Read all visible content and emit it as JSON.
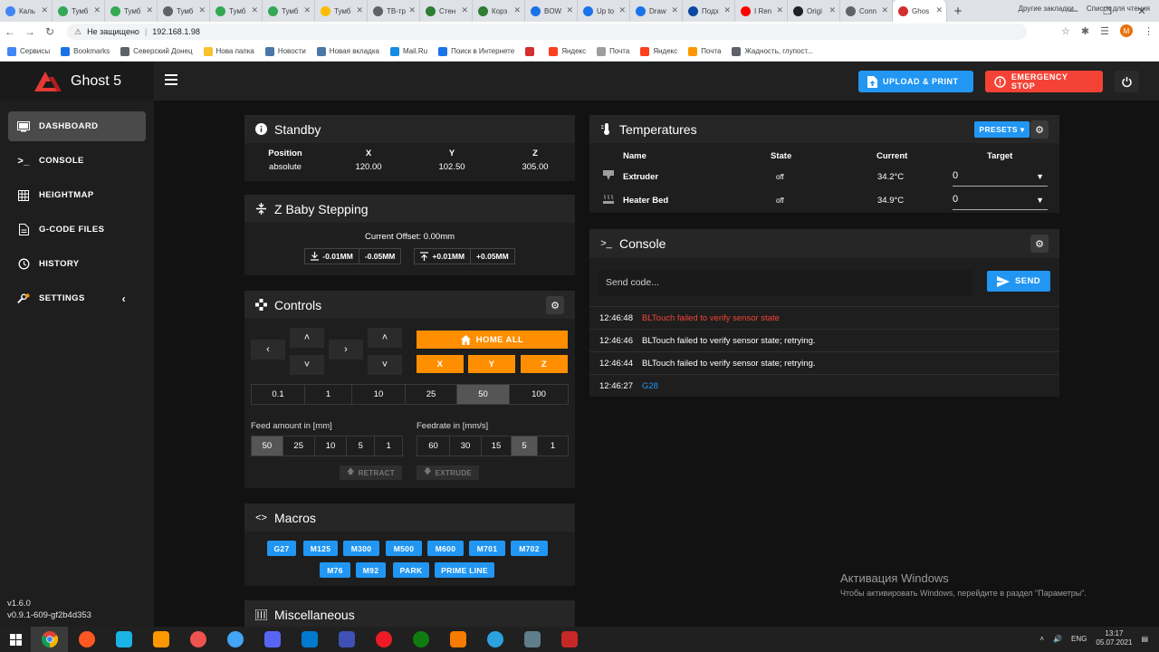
{
  "browser": {
    "tabs": [
      {
        "label": "Каль",
        "color": "#4285f4"
      },
      {
        "label": "Тумб",
        "color": "#34a853"
      },
      {
        "label": "Тумб",
        "color": "#34a853"
      },
      {
        "label": "Тумб",
        "color": "#5f6368"
      },
      {
        "label": "Тумб",
        "color": "#34a853"
      },
      {
        "label": "Тумб",
        "color": "#34a853"
      },
      {
        "label": "Тумб",
        "color": "#fbbc05"
      },
      {
        "label": "ТВ-тр",
        "color": "#5f6368"
      },
      {
        "label": "Стен",
        "color": "#2e7d32"
      },
      {
        "label": "Корз",
        "color": "#2e7d32"
      },
      {
        "label": "BOW",
        "color": "#1a73e8"
      },
      {
        "label": "Up to",
        "color": "#1a73e8"
      },
      {
        "label": "Draw",
        "color": "#1a73e8"
      },
      {
        "label": "Подх",
        "color": "#0d47a1"
      },
      {
        "label": "I Ren",
        "color": "#ff0000"
      },
      {
        "label": "Origi",
        "color": "#202124"
      },
      {
        "label": "Conn",
        "color": "#5f6368"
      }
    ],
    "active_tab": {
      "label": "Ghos",
      "color": "#d32f2f"
    },
    "security_label": "Не защищено",
    "url": "192.168.1.98",
    "profile_letter": "M",
    "bookmarks": [
      {
        "label": "Сервисы",
        "color": "#4285f4"
      },
      {
        "label": "Bookmarks",
        "color": "#1a73e8"
      },
      {
        "label": "Северский Донец",
        "color": "#5f6368"
      },
      {
        "label": "Нова папка",
        "color": "#fbc02d"
      },
      {
        "label": "Новости",
        "color": "#4a76a8"
      },
      {
        "label": "Новая вкладка",
        "color": "#4a76a8"
      },
      {
        "label": "Mail.Ru",
        "color": "#168de2"
      },
      {
        "label": "Поиск в Интернете",
        "color": "#1a73e8"
      },
      {
        "label": "",
        "color": "#d32f2f"
      },
      {
        "label": "Яндекс",
        "color": "#fc3f1d"
      },
      {
        "label": "Почта",
        "color": "#9e9e9e"
      },
      {
        "label": "Яндекс",
        "color": "#fc3f1d"
      },
      {
        "label": "Почта",
        "color": "#ff9800"
      },
      {
        "label": "Жадность, глупост...",
        "color": "#5f6368"
      }
    ],
    "bookmarks_right": [
      "Другие закладки",
      "Список для чтения"
    ]
  },
  "header": {
    "brand": "Ghost 5",
    "upload_label": "UPLOAD & PRINT",
    "estop_label": "EMERGENCY STOP"
  },
  "sidebar": {
    "items": [
      {
        "label": "DASHBOARD"
      },
      {
        "label": "CONSOLE"
      },
      {
        "label": "HEIGHTMAP"
      },
      {
        "label": "G-CODE FILES"
      },
      {
        "label": "HISTORY"
      },
      {
        "label": "SETTINGS"
      }
    ],
    "version": "v1.6.0",
    "build": "v0.9.1-609-gf2b4d353"
  },
  "status": {
    "title": "Standby",
    "headers": [
      "Position",
      "X",
      "Y",
      "Z"
    ],
    "values": [
      "absolute",
      "120.00",
      "102.50",
      "305.00"
    ]
  },
  "babystep": {
    "title": "Z Baby Stepping",
    "offset": "Current Offset: 0.00mm",
    "down": [
      "-0.01MM",
      "-0.05MM"
    ],
    "up": [
      "+0.01MM",
      "+0.05MM"
    ]
  },
  "controls": {
    "title": "Controls",
    "home_all": "HOME ALL",
    "home_axes": [
      "X",
      "Y",
      "Z"
    ],
    "steps": [
      "0.1",
      "1",
      "10",
      "25",
      "50",
      "100"
    ],
    "selected_step": "50",
    "feed_label": "Feed amount in [mm]",
    "feed_values": [
      "50",
      "25",
      "10",
      "5",
      "1"
    ],
    "feedrate_label": "Feedrate in [mm/s]",
    "feedrate_values": [
      "60",
      "30",
      "15",
      "5",
      "1"
    ],
    "retract": "RETRACT",
    "extrude": "EXTRUDE"
  },
  "macros": {
    "title": "Macros",
    "row1": [
      "G27",
      "M125",
      "M300",
      "M500",
      "M600",
      "M701",
      "M702"
    ],
    "row2": [
      "M76",
      "M92",
      "PARK",
      "PRIME LINE"
    ]
  },
  "misc": {
    "title": "Miscellaneous"
  },
  "temperatures": {
    "title": "Temperatures",
    "presets_label": "PRESETS",
    "headers": [
      "Name",
      "State",
      "Current",
      "Target"
    ],
    "rows": [
      {
        "name": "Extruder",
        "state": "off",
        "current": "34.2°C",
        "target": "0"
      },
      {
        "name": "Heater Bed",
        "state": "off",
        "current": "34.9°C",
        "target": "0"
      }
    ]
  },
  "console": {
    "title": "Console",
    "placeholder": "Send code...",
    "send_label": "SEND",
    "log": [
      {
        "time": "12:46:48",
        "message": "BLTouch failed to verify sensor state",
        "color": "#f44336"
      },
      {
        "time": "12:46:46",
        "message": "BLTouch failed to verify sensor state; retrying.",
        "color": "#ffffff"
      },
      {
        "time": "12:46:44",
        "message": "BLTouch failed to verify sensor state; retrying.",
        "color": "#ffffff"
      },
      {
        "time": "12:46:27",
        "message": "G28",
        "color": "#2196f3"
      }
    ]
  },
  "windows": {
    "activation_title": "Активация Windows",
    "activation_text": "Чтобы активировать Windows, перейдите в раздел \"Параметры\".",
    "lang": "ENG",
    "time": "13:17",
    "date": "05.07.2021"
  },
  "colors": {
    "accent": "#2196f3",
    "danger": "#f44336",
    "orange": "#ff8f00"
  }
}
